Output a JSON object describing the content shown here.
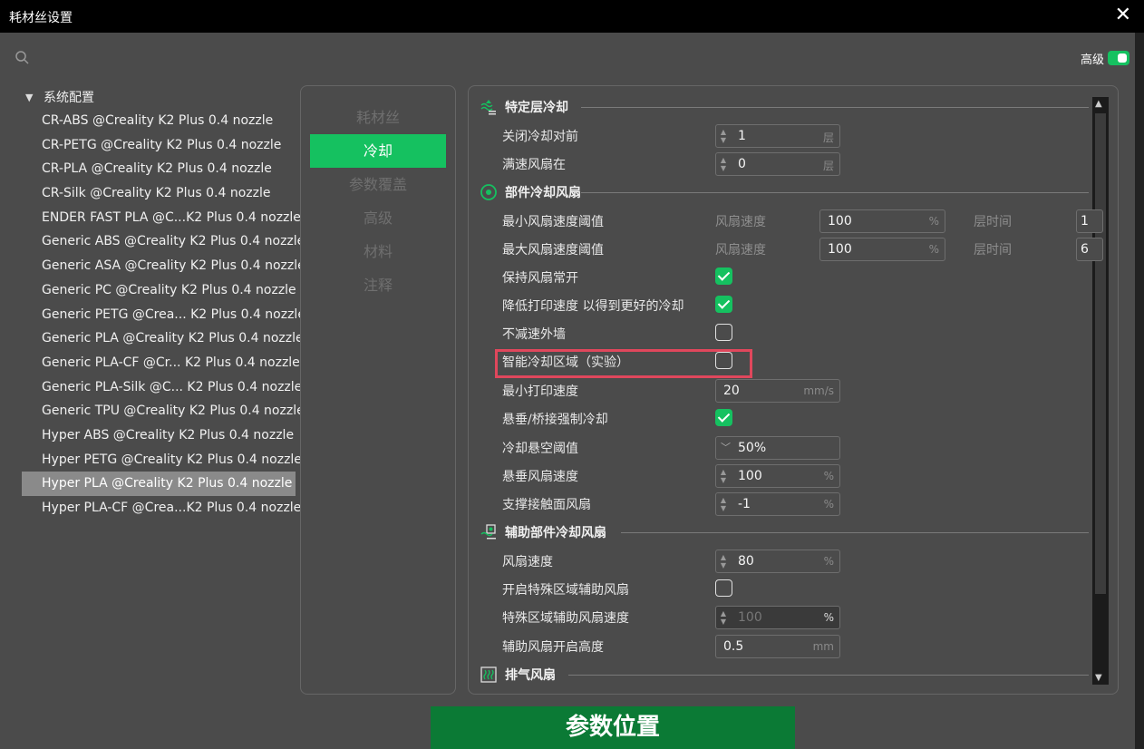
{
  "window": {
    "title": "耗材丝设置",
    "close": "✕"
  },
  "header": {
    "advanced_label": "高级",
    "advanced_on": true
  },
  "tree": {
    "group": "系统配置",
    "items": [
      "CR-ABS @Creality K2 Plus 0.4 nozzle",
      "CR-PETG @Creality K2 Plus 0.4 nozzle",
      "CR-PLA @Creality K2 Plus 0.4 nozzle",
      "CR-Silk @Creality K2 Plus 0.4 nozzle",
      "ENDER FAST PLA @C...K2 Plus 0.4 nozzle",
      "Generic ABS @Creality K2 Plus 0.4 nozzle",
      "Generic ASA @Creality K2 Plus 0.4 nozzle",
      "Generic PC @Creality K2 Plus 0.4 nozzle",
      "Generic PETG @Crea... K2 Plus 0.4 nozzle",
      "Generic PLA @Creality K2 Plus 0.4 nozzle",
      "Generic PLA-CF @Cr... K2 Plus 0.4 nozzle",
      "Generic PLA-Silk @C... K2 Plus 0.4 nozzle",
      "Generic TPU @Creality K2 Plus 0.4 nozzle",
      "Hyper ABS @Creality K2 Plus 0.4 nozzle",
      "Hyper PETG @Creality K2 Plus 0.4 nozzle",
      "Hyper PLA @Creality K2 Plus 0.4 nozzle",
      "Hyper PLA-CF @Crea...K2 Plus 0.4 nozzle"
    ],
    "selected_index": 15
  },
  "nav": {
    "items": [
      "耗材丝",
      "冷却",
      "参数覆盖",
      "高级",
      "材料",
      "注释"
    ],
    "active_index": 1
  },
  "sections": {
    "layer_cooling": "特定层冷却",
    "part_fan": "部件冷却风扇",
    "aux_fan": "辅助部件冷却风扇",
    "exhaust_fan": "排气风扇"
  },
  "layer_cooling": {
    "close_fan_label": "关闭冷却对前",
    "close_fan_value": "1",
    "close_fan_unit": "层",
    "full_fan_label": "满速风扇在",
    "full_fan_value": "0",
    "full_fan_unit": "层"
  },
  "part_fan": {
    "min_fan_label": "最小风扇速度阈值",
    "min_fan_sub": "风扇速度",
    "min_fan_value": "100",
    "min_fan_unit": "%",
    "min_layer_sub": "层时间",
    "min_layer_value": "1",
    "max_fan_label": "最大风扇速度阈值",
    "max_fan_sub": "风扇速度",
    "max_fan_value": "100",
    "max_fan_unit": "%",
    "max_layer_sub": "层时间",
    "max_layer_value": "6",
    "keep_on_label": "保持风扇常开",
    "keep_on": true,
    "slow_down_label": "降低打印速度 以得到更好的冷却",
    "slow_down": true,
    "no_slow_outer_label": "不减速外墙",
    "no_slow_outer": false,
    "smart_zone_label": "智能冷却区域（实验）",
    "smart_zone": false,
    "min_print_speed_label": "最小打印速度",
    "min_print_speed_value": "20",
    "min_print_speed_unit": "mm/s",
    "overhang_force_label": "悬垂/桥接强制冷却",
    "overhang_force": true,
    "overhang_threshold_label": "冷却悬空阈值",
    "overhang_threshold_value": "50%",
    "overhang_fan_label": "悬垂风扇速度",
    "overhang_fan_value": "100",
    "overhang_fan_unit": "%",
    "support_fan_label": "支撑接触面风扇",
    "support_fan_value": "-1",
    "support_fan_unit": "%"
  },
  "aux_fan": {
    "fan_speed_label": "风扇速度",
    "fan_speed_value": "80",
    "fan_speed_unit": "%",
    "special_zone_label": "开启特殊区域辅助风扇",
    "special_zone": false,
    "special_speed_label": "特殊区域辅助风扇速度",
    "special_speed_value": "100",
    "special_speed_unit": "%",
    "start_height_label": "辅助风扇开启高度",
    "start_height_value": "0.5",
    "start_height_unit": "mm"
  },
  "banner": "参数位置",
  "colors": {
    "accent": "#15c160",
    "highlight": "#e0475c",
    "banner": "#0b7a35"
  }
}
